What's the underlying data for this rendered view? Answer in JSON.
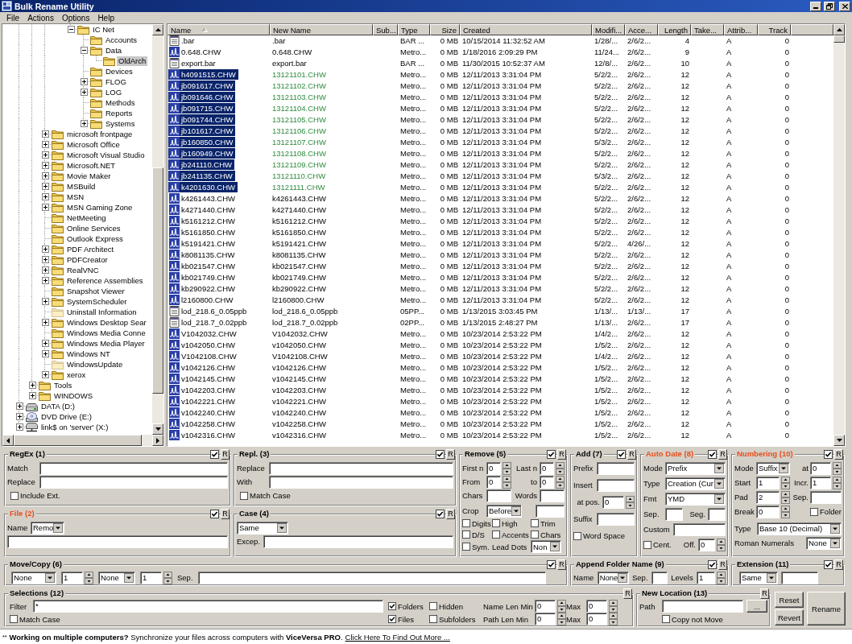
{
  "window": {
    "title": "Bulk Rename Utility"
  },
  "menu": [
    {
      "label": "File"
    },
    {
      "label": "Actions"
    },
    {
      "label": "Options"
    },
    {
      "label": "Help"
    }
  ],
  "tree": {
    "items": [
      {
        "children": [
          {
            "children": [
              {
                "children": [
                  {
                    "children": [
                      {
                        "label": "IC Net",
                        "kind": "folder",
                        "expanded": true,
                        "dimmed": false,
                        "selected": false,
                        "children": [
                          {
                            "label": "Accounts",
                            "kind": "folder",
                            "dimmed": false,
                            "selected": false
                          },
                          {
                            "label": "Data",
                            "kind": "folder",
                            "expanded": true,
                            "dimmed": false,
                            "selected": false,
                            "children": [
                              {
                                "label": "OldArch",
                                "kind": "folder",
                                "dimmed": false,
                                "selected": true
                              }
                            ]
                          },
                          {
                            "label": "Devices",
                            "kind": "folder",
                            "dimmed": false,
                            "selected": false
                          },
                          {
                            "label": "FLOG",
                            "kind": "folder",
                            "expanded": false,
                            "dimmed": false,
                            "selected": false
                          },
                          {
                            "label": "LOG",
                            "kind": "folder",
                            "expanded": false,
                            "dimmed": false,
                            "selected": false
                          },
                          {
                            "label": "Methods",
                            "kind": "folder",
                            "dimmed": false,
                            "selected": false
                          },
                          {
                            "label": "Reports",
                            "kind": "folder",
                            "dimmed": false,
                            "selected": false
                          },
                          {
                            "label": "Systems",
                            "kind": "folder",
                            "expanded": false,
                            "dimmed": false,
                            "selected": false
                          }
                        ]
                      }
                    ]
                  }
                ]
              },
              {
                "label": "microsoft frontpage",
                "kind": "folder",
                "expanded": false,
                "dimmed": false,
                "selected": false
              },
              {
                "label": "Microsoft Office",
                "kind": "folder",
                "expanded": false,
                "dimmed": false,
                "selected": false
              },
              {
                "label": "Microsoft Visual Studio",
                "kind": "folder",
                "expanded": false,
                "dimmed": false,
                "selected": false
              },
              {
                "label": "Microsoft.NET",
                "kind": "folder",
                "expanded": false,
                "dimmed": false,
                "selected": false
              },
              {
                "label": "Movie Maker",
                "kind": "folder",
                "expanded": false,
                "dimmed": false,
                "selected": false
              },
              {
                "label": "MSBuild",
                "kind": "folder",
                "expanded": false,
                "dimmed": false,
                "selected": false
              },
              {
                "label": "MSN",
                "kind": "folder",
                "expanded": false,
                "dimmed": false,
                "selected": false
              },
              {
                "label": "MSN Gaming Zone",
                "kind": "folder",
                "expanded": false,
                "dimmed": false,
                "selected": false
              },
              {
                "label": "NetMeeting",
                "kind": "folder",
                "dimmed": false,
                "selected": false
              },
              {
                "label": "Online Services",
                "kind": "folder",
                "dimmed": false,
                "selected": false
              },
              {
                "label": "Outlook Express",
                "kind": "folder",
                "dimmed": false,
                "selected": false
              },
              {
                "label": "PDF Architect",
                "kind": "folder",
                "expanded": false,
                "dimmed": false,
                "selected": false
              },
              {
                "label": "PDFCreator",
                "kind": "folder",
                "expanded": false,
                "dimmed": false,
                "selected": false
              },
              {
                "label": "RealVNC",
                "kind": "folder",
                "expanded": false,
                "dimmed": false,
                "selected": false
              },
              {
                "label": "Reference Assemblies",
                "kind": "folder",
                "expanded": false,
                "dimmed": false,
                "selected": false
              },
              {
                "label": "Snapshot Viewer",
                "kind": "folder",
                "dimmed": false,
                "selected": false
              },
              {
                "label": "SystemScheduler",
                "kind": "folder",
                "expanded": false,
                "dimmed": false,
                "selected": false
              },
              {
                "label": "Uninstall Information",
                "kind": "folder",
                "dimmed": true,
                "selected": false
              },
              {
                "label": "Windows Desktop Sear",
                "kind": "folder",
                "expanded": false,
                "dimmed": false,
                "selected": false
              },
              {
                "label": "Windows Media Conne",
                "kind": "folder",
                "dimmed": false,
                "selected": false
              },
              {
                "label": "Windows Media Player",
                "kind": "folder",
                "expanded": false,
                "dimmed": false,
                "selected": false
              },
              {
                "label": "Windows NT",
                "kind": "folder",
                "expanded": false,
                "dimmed": false,
                "selected": false
              },
              {
                "label": "WindowsUpdate",
                "kind": "folder",
                "dimmed": true,
                "selected": false
              },
              {
                "label": "xerox",
                "kind": "folder",
                "expanded": false,
                "dimmed": false,
                "selected": false
              }
            ]
          },
          {
            "label": "Tools",
            "kind": "folder",
            "expanded": false,
            "dimmed": false,
            "selected": false
          },
          {
            "label": "WINDOWS",
            "kind": "folder",
            "expanded": false,
            "dimmed": false,
            "selected": false
          }
        ]
      },
      {
        "label": "DATA (D:)",
        "kind": "disk",
        "expanded": false,
        "dimmed": false,
        "selected": false
      },
      {
        "label": "DVD Drive (E:)",
        "kind": "dvd",
        "expanded": false,
        "dimmed": false,
        "selected": false
      },
      {
        "label": "link$ on 'server' (X:)",
        "kind": "network",
        "expanded": false,
        "dimmed": false,
        "selected": false
      }
    ]
  },
  "file_list": {
    "columns": [
      {
        "label": "Name",
        "sorted": true
      },
      {
        "label": "New Name",
        "sorted": false
      },
      {
        "label": "Sub...",
        "sorted": false
      },
      {
        "label": "Type",
        "sorted": false
      },
      {
        "label": "Size",
        "sorted": false
      },
      {
        "label": "Created",
        "sorted": false
      },
      {
        "label": "Modifi...",
        "sorted": false
      },
      {
        "label": "Acce...",
        "sorted": false
      },
      {
        "label": "Length",
        "sorted": false
      },
      {
        "label": "Take...",
        "sorted": false
      },
      {
        "label": "Attrib...",
        "sorted": false
      },
      {
        "label": "Track",
        "sorted": false
      }
    ],
    "rows": [
      {
        "kind": "document",
        "name": ".bar",
        "new_name": ".bar",
        "changed": false,
        "selected": false,
        "type": "BAR ...",
        "size": "0 MB",
        "created": "10/15/2014 11:32:52 AM",
        "modified": "1/28/...",
        "accessed": "2/6/2...",
        "length": "4",
        "attributes": "A",
        "track": "0"
      },
      {
        "kind": "data",
        "name": "0.648.CHW",
        "new_name": "0.648.CHW",
        "changed": false,
        "selected": false,
        "type": "Metro...",
        "size": "0 MB",
        "created": "1/18/2016 2:09:29 PM",
        "modified": "11/24...",
        "accessed": "2/6/2...",
        "length": "9",
        "attributes": "A",
        "track": "0"
      },
      {
        "kind": "document",
        "name": "export.bar",
        "new_name": "export.bar",
        "changed": false,
        "selected": false,
        "type": "BAR ...",
        "size": "0 MB",
        "created": "11/30/2015 10:52:37 AM",
        "modified": "12/8/...",
        "accessed": "2/6/2...",
        "length": "10",
        "attributes": "A",
        "track": "0"
      },
      {
        "kind": "data",
        "name": "h4091515.CHW",
        "new_name": "13121101.CHW",
        "changed": true,
        "selected": true,
        "type": "Metro...",
        "size": "0 MB",
        "created": "12/11/2013 3:31:04 PM",
        "modified": "5/2/2...",
        "accessed": "2/6/2...",
        "length": "12",
        "attributes": "A",
        "track": "0"
      },
      {
        "kind": "data",
        "name": "jb091617.CHW",
        "new_name": "13121102.CHW",
        "changed": true,
        "selected": true,
        "type": "Metro...",
        "size": "0 MB",
        "created": "12/11/2013 3:31:04 PM",
        "modified": "5/2/2...",
        "accessed": "2/6/2...",
        "length": "12",
        "attributes": "A",
        "track": "0"
      },
      {
        "kind": "data",
        "name": "jb091646.CHW",
        "new_name": "13121103.CHW",
        "changed": true,
        "selected": true,
        "type": "Metro...",
        "size": "0 MB",
        "created": "12/11/2013 3:31:04 PM",
        "modified": "5/2/2...",
        "accessed": "2/6/2...",
        "length": "12",
        "attributes": "A",
        "track": "0"
      },
      {
        "kind": "data",
        "name": "jb091715.CHW",
        "new_name": "13121104.CHW",
        "changed": true,
        "selected": true,
        "type": "Metro...",
        "size": "0 MB",
        "created": "12/11/2013 3:31:04 PM",
        "modified": "5/2/2...",
        "accessed": "2/6/2...",
        "length": "12",
        "attributes": "A",
        "track": "0"
      },
      {
        "kind": "data",
        "name": "jb091744.CHW",
        "new_name": "13121105.CHW",
        "changed": true,
        "selected": true,
        "type": "Metro...",
        "size": "0 MB",
        "created": "12/11/2013 3:31:04 PM",
        "modified": "5/2/2...",
        "accessed": "2/6/2...",
        "length": "12",
        "attributes": "A",
        "track": "0"
      },
      {
        "kind": "data",
        "name": "jb101617.CHW",
        "new_name": "13121106.CHW",
        "changed": true,
        "selected": true,
        "type": "Metro...",
        "size": "0 MB",
        "created": "12/11/2013 3:31:04 PM",
        "modified": "5/2/2...",
        "accessed": "2/6/2...",
        "length": "12",
        "attributes": "A",
        "track": "0"
      },
      {
        "kind": "data",
        "name": "jb160850.CHW",
        "new_name": "13121107.CHW",
        "changed": true,
        "selected": true,
        "type": "Metro...",
        "size": "0 MB",
        "created": "12/11/2013 3:31:04 PM",
        "modified": "5/3/2...",
        "accessed": "2/6/2...",
        "length": "12",
        "attributes": "A",
        "track": "0"
      },
      {
        "kind": "data",
        "name": "jb160949.CHW",
        "new_name": "13121108.CHW",
        "changed": true,
        "selected": true,
        "type": "Metro...",
        "size": "0 MB",
        "created": "12/11/2013 3:31:04 PM",
        "modified": "5/2/2...",
        "accessed": "2/6/2...",
        "length": "12",
        "attributes": "A",
        "track": "0"
      },
      {
        "kind": "data",
        "name": "jb241110.CHW",
        "new_name": "13121109.CHW",
        "changed": true,
        "selected": true,
        "type": "Metro...",
        "size": "0 MB",
        "created": "12/11/2013 3:31:04 PM",
        "modified": "5/2/2...",
        "accessed": "2/6/2...",
        "length": "12",
        "attributes": "A",
        "track": "0"
      },
      {
        "kind": "data",
        "name": "jb241135.CHW",
        "new_name": "13121110.CHW",
        "changed": true,
        "selected": true,
        "type": "Metro...",
        "size": "0 MB",
        "created": "12/11/2013 3:31:04 PM",
        "modified": "5/3/2...",
        "accessed": "2/6/2...",
        "length": "12",
        "attributes": "A",
        "track": "0"
      },
      {
        "kind": "data",
        "name": "k4201630.CHW",
        "new_name": "13121111.CHW",
        "changed": true,
        "selected": true,
        "type": "Metro...",
        "size": "0 MB",
        "created": "12/11/2013 3:31:04 PM",
        "modified": "5/2/2...",
        "accessed": "2/6/2...",
        "length": "12",
        "attributes": "A",
        "track": "0"
      },
      {
        "kind": "data",
        "name": "k4261443.CHW",
        "new_name": "k4261443.CHW",
        "changed": false,
        "selected": false,
        "type": "Metro...",
        "size": "0 MB",
        "created": "12/11/2013 3:31:04 PM",
        "modified": "5/2/2...",
        "accessed": "2/6/2...",
        "length": "12",
        "attributes": "A",
        "track": "0"
      },
      {
        "kind": "data",
        "name": "k4271440.CHW",
        "new_name": "k4271440.CHW",
        "changed": false,
        "selected": false,
        "type": "Metro...",
        "size": "0 MB",
        "created": "12/11/2013 3:31:04 PM",
        "modified": "5/2/2...",
        "accessed": "2/6/2...",
        "length": "12",
        "attributes": "A",
        "track": "0"
      },
      {
        "kind": "data",
        "name": "k5161212.CHW",
        "new_name": "k5161212.CHW",
        "changed": false,
        "selected": false,
        "type": "Metro...",
        "size": "0 MB",
        "created": "12/11/2013 3:31:04 PM",
        "modified": "5/2/2...",
        "accessed": "2/6/2...",
        "length": "12",
        "attributes": "A",
        "track": "0"
      },
      {
        "kind": "data",
        "name": "k5161850.CHW",
        "new_name": "k5161850.CHW",
        "changed": false,
        "selected": false,
        "type": "Metro...",
        "size": "0 MB",
        "created": "12/11/2013 3:31:04 PM",
        "modified": "5/2/2...",
        "accessed": "2/6/2...",
        "length": "12",
        "attributes": "A",
        "track": "0"
      },
      {
        "kind": "data",
        "name": "k5191421.CHW",
        "new_name": "k5191421.CHW",
        "changed": false,
        "selected": false,
        "type": "Metro...",
        "size": "0 MB",
        "created": "12/11/2013 3:31:04 PM",
        "modified": "5/2/2...",
        "accessed": "4/26/...",
        "length": "12",
        "attributes": "A",
        "track": "0"
      },
      {
        "kind": "data",
        "name": "k8081135.CHW",
        "new_name": "k8081135.CHW",
        "changed": false,
        "selected": false,
        "type": "Metro...",
        "size": "0 MB",
        "created": "12/11/2013 3:31:04 PM",
        "modified": "5/2/2...",
        "accessed": "2/6/2...",
        "length": "12",
        "attributes": "A",
        "track": "0"
      },
      {
        "kind": "data",
        "name": "kb021547.CHW",
        "new_name": "kb021547.CHW",
        "changed": false,
        "selected": false,
        "type": "Metro...",
        "size": "0 MB",
        "created": "12/11/2013 3:31:04 PM",
        "modified": "5/2/2...",
        "accessed": "2/6/2...",
        "length": "12",
        "attributes": "A",
        "track": "0"
      },
      {
        "kind": "data",
        "name": "kb021749.CHW",
        "new_name": "kb021749.CHW",
        "changed": false,
        "selected": false,
        "type": "Metro...",
        "size": "0 MB",
        "created": "12/11/2013 3:31:04 PM",
        "modified": "5/2/2...",
        "accessed": "2/6/2...",
        "length": "12",
        "attributes": "A",
        "track": "0"
      },
      {
        "kind": "data",
        "name": "kb290922.CHW",
        "new_name": "kb290922.CHW",
        "changed": false,
        "selected": false,
        "type": "Metro...",
        "size": "0 MB",
        "created": "12/11/2013 3:31:04 PM",
        "modified": "5/2/2...",
        "accessed": "2/6/2...",
        "length": "12",
        "attributes": "A",
        "track": "0"
      },
      {
        "kind": "data",
        "name": "l2160800.CHW",
        "new_name": "l2160800.CHW",
        "changed": false,
        "selected": false,
        "type": "Metro...",
        "size": "0 MB",
        "created": "12/11/2013 3:31:04 PM",
        "modified": "5/2/2...",
        "accessed": "2/6/2...",
        "length": "12",
        "attributes": "A",
        "track": "0"
      },
      {
        "kind": "document",
        "name": "lod_218.6_0.05ppb",
        "new_name": "lod_218.6_0.05ppb",
        "changed": false,
        "selected": false,
        "type": "05PP...",
        "size": "0 MB",
        "created": "1/13/2015 3:03:45 PM",
        "modified": "1/13/...",
        "accessed": "1/13/...",
        "length": "17",
        "attributes": "A",
        "track": "0"
      },
      {
        "kind": "document",
        "name": "lod_218.7_0.02ppb",
        "new_name": "lod_218.7_0.02ppb",
        "changed": false,
        "selected": false,
        "type": "02PP...",
        "size": "0 MB",
        "created": "1/13/2015 2:48:27 PM",
        "modified": "1/13/...",
        "accessed": "2/6/2...",
        "length": "17",
        "attributes": "A",
        "track": "0"
      },
      {
        "kind": "data",
        "name": "V1042032.CHW",
        "new_name": "V1042032.CHW",
        "changed": false,
        "selected": false,
        "type": "Metro...",
        "size": "0 MB",
        "created": "10/23/2014 2:53:22 PM",
        "modified": "1/4/2...",
        "accessed": "2/6/2...",
        "length": "12",
        "attributes": "A",
        "track": "0"
      },
      {
        "kind": "data",
        "name": "v1042050.CHW",
        "new_name": "v1042050.CHW",
        "changed": false,
        "selected": false,
        "type": "Metro...",
        "size": "0 MB",
        "created": "10/23/2014 2:53:22 PM",
        "modified": "1/5/2...",
        "accessed": "2/6/2...",
        "length": "12",
        "attributes": "A",
        "track": "0"
      },
      {
        "kind": "data",
        "name": "V1042108.CHW",
        "new_name": "V1042108.CHW",
        "changed": false,
        "selected": false,
        "type": "Metro...",
        "size": "0 MB",
        "created": "10/23/2014 2:53:22 PM",
        "modified": "1/4/2...",
        "accessed": "2/6/2...",
        "length": "12",
        "attributes": "A",
        "track": "0"
      },
      {
        "kind": "data",
        "name": "v1042126.CHW",
        "new_name": "v1042126.CHW",
        "changed": false,
        "selected": false,
        "type": "Metro...",
        "size": "0 MB",
        "created": "10/23/2014 2:53:22 PM",
        "modified": "1/5/2...",
        "accessed": "2/6/2...",
        "length": "12",
        "attributes": "A",
        "track": "0"
      },
      {
        "kind": "data",
        "name": "v1042145.CHW",
        "new_name": "v1042145.CHW",
        "changed": false,
        "selected": false,
        "type": "Metro...",
        "size": "0 MB",
        "created": "10/23/2014 2:53:22 PM",
        "modified": "1/5/2...",
        "accessed": "2/6/2...",
        "length": "12",
        "attributes": "A",
        "track": "0"
      },
      {
        "kind": "data",
        "name": "v1042203.CHW",
        "new_name": "v1042203.CHW",
        "changed": false,
        "selected": false,
        "type": "Metro...",
        "size": "0 MB",
        "created": "10/23/2014 2:53:22 PM",
        "modified": "1/5/2...",
        "accessed": "2/6/2...",
        "length": "12",
        "attributes": "A",
        "track": "0"
      },
      {
        "kind": "data",
        "name": "v1042221.CHW",
        "new_name": "v1042221.CHW",
        "changed": false,
        "selected": false,
        "type": "Metro...",
        "size": "0 MB",
        "created": "10/23/2014 2:53:22 PM",
        "modified": "1/5/2...",
        "accessed": "2/6/2...",
        "length": "12",
        "attributes": "A",
        "track": "0"
      },
      {
        "kind": "data",
        "name": "v1042240.CHW",
        "new_name": "v1042240.CHW",
        "changed": false,
        "selected": false,
        "type": "Metro...",
        "size": "0 MB",
        "created": "10/23/2014 2:53:22 PM",
        "modified": "1/5/2...",
        "accessed": "2/6/2...",
        "length": "12",
        "attributes": "A",
        "track": "0"
      },
      {
        "kind": "data",
        "name": "v1042258.CHW",
        "new_name": "v1042258.CHW",
        "changed": false,
        "selected": false,
        "type": "Metro...",
        "size": "0 MB",
        "created": "10/23/2014 2:53:22 PM",
        "modified": "1/5/2...",
        "accessed": "2/6/2...",
        "length": "12",
        "attributes": "A",
        "track": "0"
      },
      {
        "kind": "data",
        "name": "v1042316.CHW",
        "new_name": "v1042316.CHW",
        "changed": false,
        "selected": false,
        "type": "Metro...",
        "size": "0 MB",
        "created": "10/23/2014 2:53:22 PM",
        "modified": "1/5/2...",
        "accessed": "2/6/2...",
        "length": "12",
        "attributes": "A",
        "track": "0"
      }
    ]
  },
  "panels": [
    {
      "kind": "regex",
      "title": "RegEx (1)",
      "active": false,
      "enabled": true,
      "reset": "R",
      "rows": [
        [
          {
            "kind": "label",
            "text": "Match"
          },
          {
            "kind": "field"
          }
        ],
        [
          {
            "kind": "label",
            "text": "Replace"
          },
          {
            "kind": "field"
          }
        ],
        [
          {
            "kind": "checkbox",
            "label": "Include Ext.",
            "checked": false
          }
        ]
      ]
    },
    {
      "kind": "repl",
      "title": "Repl. (3)",
      "active": false,
      "enabled": true,
      "reset": "R",
      "rows": [
        [
          {
            "kind": "label",
            "text": "Replace"
          },
          {
            "kind": "field"
          }
        ],
        [
          {
            "kind": "label",
            "text": "With"
          },
          {
            "kind": "field"
          }
        ],
        [
          {
            "kind": "checkbox",
            "label": "Match Case",
            "checked": false
          }
        ]
      ]
    },
    {
      "kind": "remove",
      "title": "Remove (5)",
      "active": false,
      "enabled": true,
      "reset": "R",
      "rows": [
        [
          {
            "kind": "label",
            "text": "First n"
          },
          {
            "kind": "number",
            "value": "0"
          },
          {
            "kind": "label",
            "text": "Last n"
          },
          {
            "kind": "number",
            "value": "0"
          }
        ],
        [
          {
            "kind": "label",
            "text": "From"
          },
          {
            "kind": "number",
            "value": "0"
          },
          {
            "kind": "label",
            "text": "to"
          },
          {
            "kind": "number",
            "value": "0"
          }
        ],
        [
          {
            "kind": "label",
            "text": "Chars"
          },
          {
            "kind": "field"
          },
          {
            "kind": "label",
            "text": "Words"
          },
          {
            "kind": "field"
          }
        ],
        [
          {
            "kind": "label",
            "text": "Crop"
          },
          {
            "kind": "dropdown",
            "value": "Before"
          },
          {
            "kind": "field"
          }
        ],
        [
          {
            "kind": "checkbox",
            "label": "Digits",
            "checked": false
          },
          {
            "kind": "checkbox",
            "label": "High",
            "checked": false
          },
          {
            "kind": "checkbox",
            "label": "Trim",
            "checked": false
          }
        ],
        [
          {
            "kind": "checkbox",
            "label": "D/S",
            "checked": false
          },
          {
            "kind": "checkbox",
            "label": "Accents",
            "checked": false
          },
          {
            "kind": "checkbox",
            "label": "Chars",
            "checked": false
          }
        ],
        [
          {
            "kind": "checkbox",
            "label": "Sym.",
            "checked": false
          },
          {
            "kind": "label",
            "text": "Lead Dots"
          },
          {
            "kind": "dropdown",
            "value": "Non"
          }
        ]
      ]
    },
    {
      "kind": "add",
      "title": "Add (7)",
      "active": false,
      "enabled": true,
      "reset": "R",
      "rows": [
        [
          {
            "kind": "label",
            "text": "Prefix"
          },
          {
            "kind": "field"
          }
        ],
        [
          {
            "kind": "label",
            "text": "Insert"
          },
          {
            "kind": "field"
          }
        ],
        [
          {
            "kind": "label",
            "text": "at pos."
          },
          {
            "kind": "number",
            "value": "0"
          }
        ],
        [
          {
            "kind": "label",
            "text": "Suffix"
          },
          {
            "kind": "field"
          }
        ],
        [
          {
            "kind": "checkbox",
            "label": "Word Space",
            "checked": false
          }
        ]
      ]
    },
    {
      "kind": "auto_date",
      "title": "Auto Date (8)",
      "active": true,
      "enabled": true,
      "reset": "R",
      "rows": [
        [
          {
            "kind": "label",
            "text": "Mode"
          },
          {
            "kind": "dropdown",
            "value": "Prefix"
          }
        ],
        [
          {
            "kind": "label",
            "text": "Type"
          },
          {
            "kind": "dropdown",
            "value": "Creation (Cur"
          }
        ],
        [
          {
            "kind": "label",
            "text": "Fmt"
          },
          {
            "kind": "dropdown",
            "value": "YMD"
          }
        ],
        [
          {
            "kind": "label",
            "text": "Sep."
          },
          {
            "kind": "field"
          },
          {
            "kind": "label",
            "text": "Seg."
          },
          {
            "kind": "field"
          }
        ],
        [
          {
            "kind": "label",
            "text": "Custom"
          },
          {
            "kind": "field"
          }
        ],
        [
          {
            "kind": "checkbox",
            "label": "Cent.",
            "checked": false
          },
          {
            "kind": "label",
            "text": "Off."
          },
          {
            "kind": "number",
            "value": "0"
          }
        ]
      ]
    },
    {
      "kind": "numbering",
      "title": "Numbering (10)",
      "active": true,
      "enabled": true,
      "reset": "R",
      "rows": [
        [
          {
            "kind": "label",
            "text": "Mode"
          },
          {
            "kind": "dropdown",
            "value": "Suffix"
          },
          {
            "kind": "label",
            "text": "at"
          },
          {
            "kind": "number",
            "value": "0"
          }
        ],
        [
          {
            "kind": "label",
            "text": "Start"
          },
          {
            "kind": "number",
            "value": "1"
          },
          {
            "kind": "label",
            "text": "Incr."
          },
          {
            "kind": "number",
            "value": "1"
          }
        ],
        [
          {
            "kind": "label",
            "text": "Pad"
          },
          {
            "kind": "number",
            "value": "2"
          },
          {
            "kind": "label",
            "text": "Sep."
          },
          {
            "kind": "field"
          }
        ],
        [
          {
            "kind": "label",
            "text": "Break"
          },
          {
            "kind": "number",
            "value": "0"
          },
          {
            "kind": "checkbox",
            "label": "Folder",
            "checked": false
          }
        ],
        [
          {
            "kind": "label",
            "text": "Type"
          },
          {
            "kind": "dropdown",
            "value": "Base 10 (Decimal)"
          }
        ],
        [
          {
            "kind": "label",
            "text": "Roman Numerals"
          },
          {
            "kind": "dropdown",
            "value": "None"
          }
        ]
      ]
    },
    {
      "kind": "file",
      "title": "File (2)",
      "active": true,
      "enabled": true,
      "reset": "R",
      "rows": [
        [
          {
            "kind": "label",
            "text": "Name"
          },
          {
            "kind": "dropdown",
            "value": "Remo"
          }
        ],
        [
          {
            "kind": "field"
          }
        ]
      ]
    },
    {
      "kind": "case",
      "title": "Case (4)",
      "active": false,
      "enabled": true,
      "reset": "R",
      "rows": [
        [
          {
            "kind": "dropdown",
            "value": "Same"
          }
        ],
        [
          {
            "kind": "label",
            "text": "Excep."
          },
          {
            "kind": "field"
          }
        ]
      ]
    },
    {
      "kind": "move_copy",
      "title": "Move/Copy (6)",
      "active": false,
      "enabled": true,
      "reset": "R",
      "rows": [
        [
          {
            "kind": "dropdown",
            "value": "None"
          },
          {
            "kind": "number",
            "value": "1"
          },
          {
            "kind": "dropdown",
            "value": "None"
          },
          {
            "kind": "number",
            "value": "1"
          },
          {
            "kind": "label",
            "text": "Sep."
          },
          {
            "kind": "field"
          }
        ]
      ]
    },
    {
      "kind": "append_folder",
      "title": "Append Folder Name (9)",
      "active": false,
      "enabled": true,
      "reset": "R",
      "rows": [
        [
          {
            "kind": "label",
            "text": "Name"
          },
          {
            "kind": "dropdown",
            "value": "None"
          },
          {
            "kind": "label",
            "text": "Sep."
          },
          {
            "kind": "field"
          },
          {
            "kind": "label",
            "text": "Levels"
          },
          {
            "kind": "number",
            "value": "1"
          }
        ]
      ]
    },
    {
      "kind": "extension",
      "title": "Extension (11)",
      "active": false,
      "enabled": true,
      "reset": "R",
      "rows": [
        [
          {
            "kind": "dropdown",
            "value": "Same"
          },
          {
            "kind": "field"
          }
        ]
      ]
    },
    {
      "kind": "selections",
      "title": "Selections (12)",
      "active": false,
      "reset": "R",
      "rows": [
        [
          {
            "kind": "label",
            "text": "Filter"
          },
          {
            "kind": "field",
            "value": "*"
          },
          {
            "kind": "checkbox",
            "label": "Folders",
            "checked": true
          },
          {
            "kind": "checkbox",
            "label": "Hidden",
            "checked": false
          },
          {
            "kind": "label",
            "text": "Name Len Min"
          },
          {
            "kind": "number",
            "value": "0"
          },
          {
            "kind": "label",
            "text": "Max"
          },
          {
            "kind": "number",
            "value": "0"
          }
        ],
        [
          "",
          {
            "kind": "checkbox",
            "label": "Match Case",
            "checked": false
          },
          {
            "kind": "checkbox",
            "label": "Files",
            "checked": true
          },
          {
            "kind": "checkbox",
            "label": "Subfolders",
            "checked": false
          },
          {
            "kind": "label",
            "text": "Path Len Min"
          },
          {
            "kind": "number",
            "value": "0"
          },
          {
            "kind": "label",
            "text": "Max"
          },
          {
            "kind": "number",
            "value": "0"
          }
        ]
      ]
    },
    {
      "kind": "new_location",
      "title": "New Location (13)",
      "active": false,
      "reset": "R",
      "rows": [
        [
          {
            "kind": "label",
            "text": "Path"
          },
          {
            "kind": "field"
          },
          {
            "kind": "button",
            "label": "..."
          }
        ],
        [
          {
            "kind": "checkbox",
            "label": "Copy not Move",
            "checked": false
          }
        ]
      ]
    }
  ],
  "actions": [
    {
      "label": "Reset"
    },
    {
      "label": "Revert"
    },
    {
      "label": "Rename"
    }
  ],
  "footer": {
    "marker": "**",
    "message": "**Working on multiple computers?** Synchronize your files across computers with **ViceVersa PRO**.",
    "link": "Click Here To Find Out More ..."
  }
}
